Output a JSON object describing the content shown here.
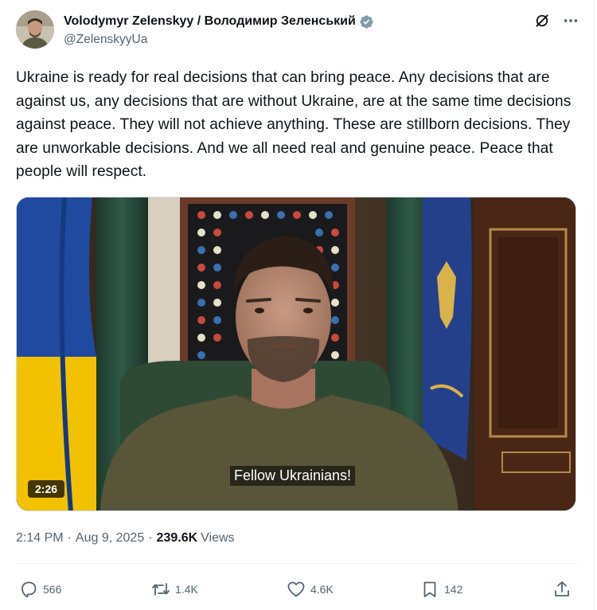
{
  "author": {
    "display_name": "Volodymyr Zelenskyy / Володимир Зеленський",
    "handle": "@ZelenskyyUa",
    "verified": true,
    "verified_color": "#829aab"
  },
  "header_actions": {
    "grok_icon": "grok-icon",
    "more_icon": "more-options-icon"
  },
  "tweet": {
    "text": "Ukraine is ready for real decisions that can bring peace. Any decisions that are against us, any decisions that are without Ukraine, are at the same time decisions against peace. They will not achieve anything. These are stillborn decisions. They are unworkable decisions. And we all need real and genuine peace. Peace that people will respect."
  },
  "media": {
    "duration": "2:26",
    "subtitle": "Fellow Ukrainians!"
  },
  "meta": {
    "time": "2:14 PM",
    "date": "Aug 9, 2025",
    "views_count": "239.6K",
    "views_label": "Views"
  },
  "engagement": {
    "replies": "566",
    "reposts": "1.4K",
    "likes": "4.6K",
    "bookmarks": "142"
  },
  "colors": {
    "text_primary": "#0f1419",
    "text_secondary": "#536471",
    "divider": "#eff3f4"
  }
}
